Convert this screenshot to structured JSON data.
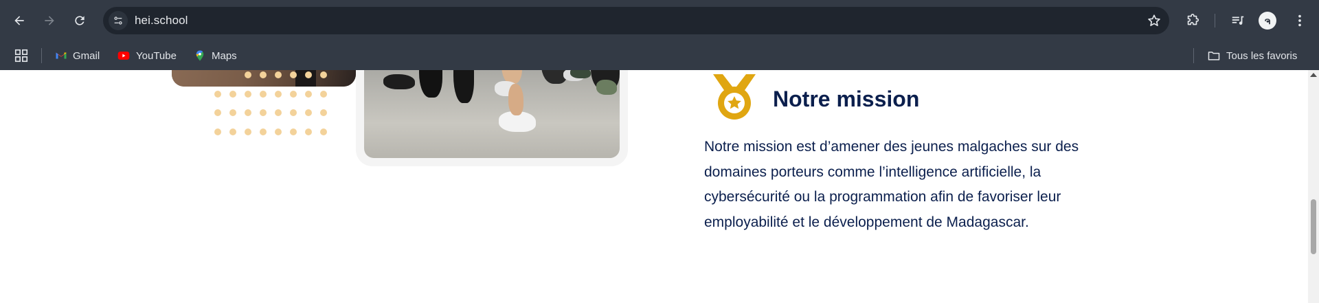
{
  "browser": {
    "url": "hei.school",
    "bookmarks": [
      {
        "label": "Gmail",
        "icon": "gmail-icon"
      },
      {
        "label": "YouTube",
        "icon": "youtube-icon"
      },
      {
        "label": "Maps",
        "icon": "maps-icon"
      }
    ],
    "all_bookmarks_label": "Tous les favoris",
    "profile_initial": "ຈ"
  },
  "colors": {
    "chrome_bg": "#333a45",
    "omnibox_bg": "#1f252e",
    "heading": "#0b1f4d",
    "medal_gold": "#e0a611",
    "dot_color": "#f3d29a"
  },
  "mission": {
    "title": "Notre mission",
    "icon": "medal-icon",
    "body": "Notre mission est d’amener des jeunes malgaches sur des domaines porteurs comme l’intelligence artificielle, la cybersécurité ou la programmation afin de favoriser leur employabilité et le développement de Madagascar."
  }
}
